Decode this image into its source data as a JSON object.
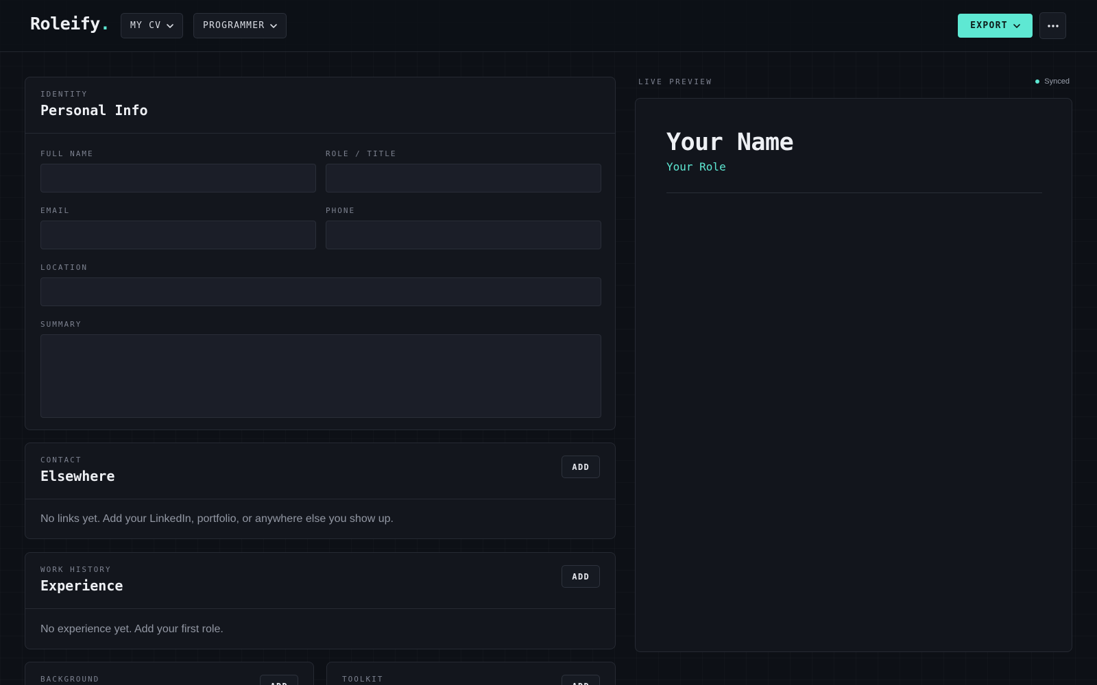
{
  "app": {
    "brand": "Roleify",
    "brand_dot": ".",
    "accent": "#5ee8d3"
  },
  "header": {
    "cv_select": "MY CV",
    "role_select": "PROGRAMMER",
    "export_label": "EXPORT",
    "more_icon": "ellipsis-icon"
  },
  "personal": {
    "eyebrow": "IDENTITY",
    "title": "Personal Info",
    "fields": {
      "full_name": {
        "label": "FULL NAME",
        "value": ""
      },
      "role": {
        "label": "ROLE / TITLE",
        "value": ""
      },
      "email": {
        "label": "EMAIL",
        "value": ""
      },
      "phone": {
        "label": "PHONE",
        "value": ""
      },
      "location": {
        "label": "LOCATION",
        "value": ""
      },
      "summary": {
        "label": "SUMMARY",
        "value": ""
      }
    }
  },
  "contact": {
    "eyebrow": "CONTACT",
    "title": "Elsewhere",
    "add_label": "ADD",
    "empty": "No links yet. Add your LinkedIn, portfolio, or anywhere else you show up."
  },
  "experience": {
    "eyebrow": "WORK HISTORY",
    "title": "Experience",
    "add_label": "ADD",
    "empty": "No experience yet. Add your first role."
  },
  "background": {
    "eyebrow": "BACKGROUND",
    "add_label": "ADD"
  },
  "toolkit": {
    "eyebrow": "TOOLKIT",
    "add_label": "ADD"
  },
  "preview": {
    "label": "LIVE PREVIEW",
    "status": "Synced",
    "name": "Your Name",
    "role": "Your Role"
  }
}
